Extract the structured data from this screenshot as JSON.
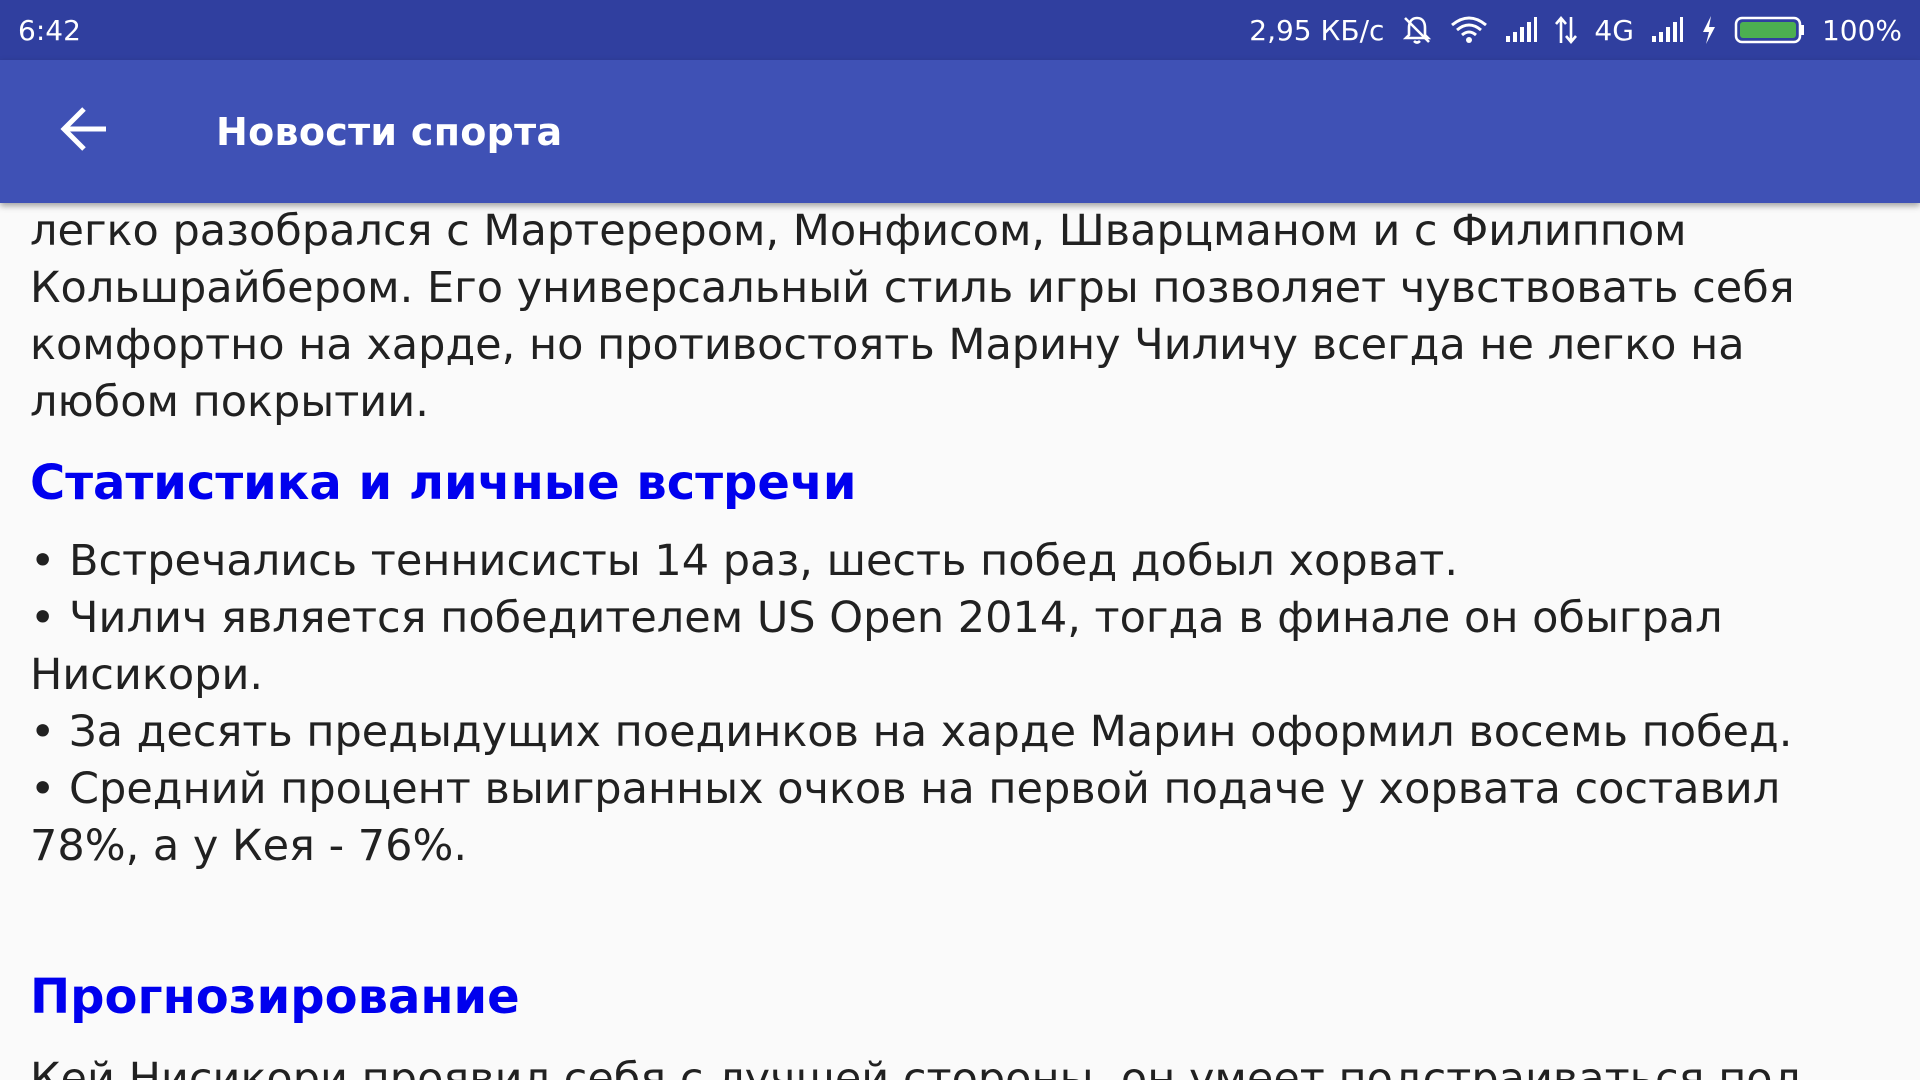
{
  "status_bar": {
    "time": "6:42",
    "network_speed": "2,95 КБ/с",
    "network_type": "4G",
    "battery": "100%",
    "icons": [
      "bell-off-icon",
      "wifi-icon",
      "signal-icon",
      "data-arrows-icon",
      "signal-icon",
      "charging-icon",
      "battery-icon"
    ]
  },
  "app_bar": {
    "title": "Новости спорта",
    "back_icon": "arrow-left-icon"
  },
  "colors": {
    "status_bar": "#303f9f",
    "app_bar": "#3f51b5",
    "heading": "#0000ee",
    "text": "#212121",
    "background": "#fafafa"
  },
  "article": {
    "intro_paragraph": "легко разобрался с Мартерером, Монфисом, Шварцманом и с Филиппом Кольшрайбером. Его универсальный стиль игры позволяет чувствовать себя комфортно на харде, но противостоять Марину Чиличу всегда не легко на любом покрытии.",
    "stats_heading": "Статистика и личные встречи",
    "bullets": [
      " • Встречались теннисисты 14 раз, шесть побед добыл хорват.",
      " • Чилич является победителем US Open 2014, тогда в финале он обыграл Нисикори.",
      " • За десять предыдущих поединков на харде Марин оформил восемь побед.",
      " • Средний процент выигранных очков на первой подаче у хорвата составил 78%, а у Кея - 76%."
    ],
    "forecast_heading": "Прогнозирование",
    "forecast_paragraph": " Кей Нисикори проявил себя с лучшей стороны, он умеет подстраиваться под"
  }
}
